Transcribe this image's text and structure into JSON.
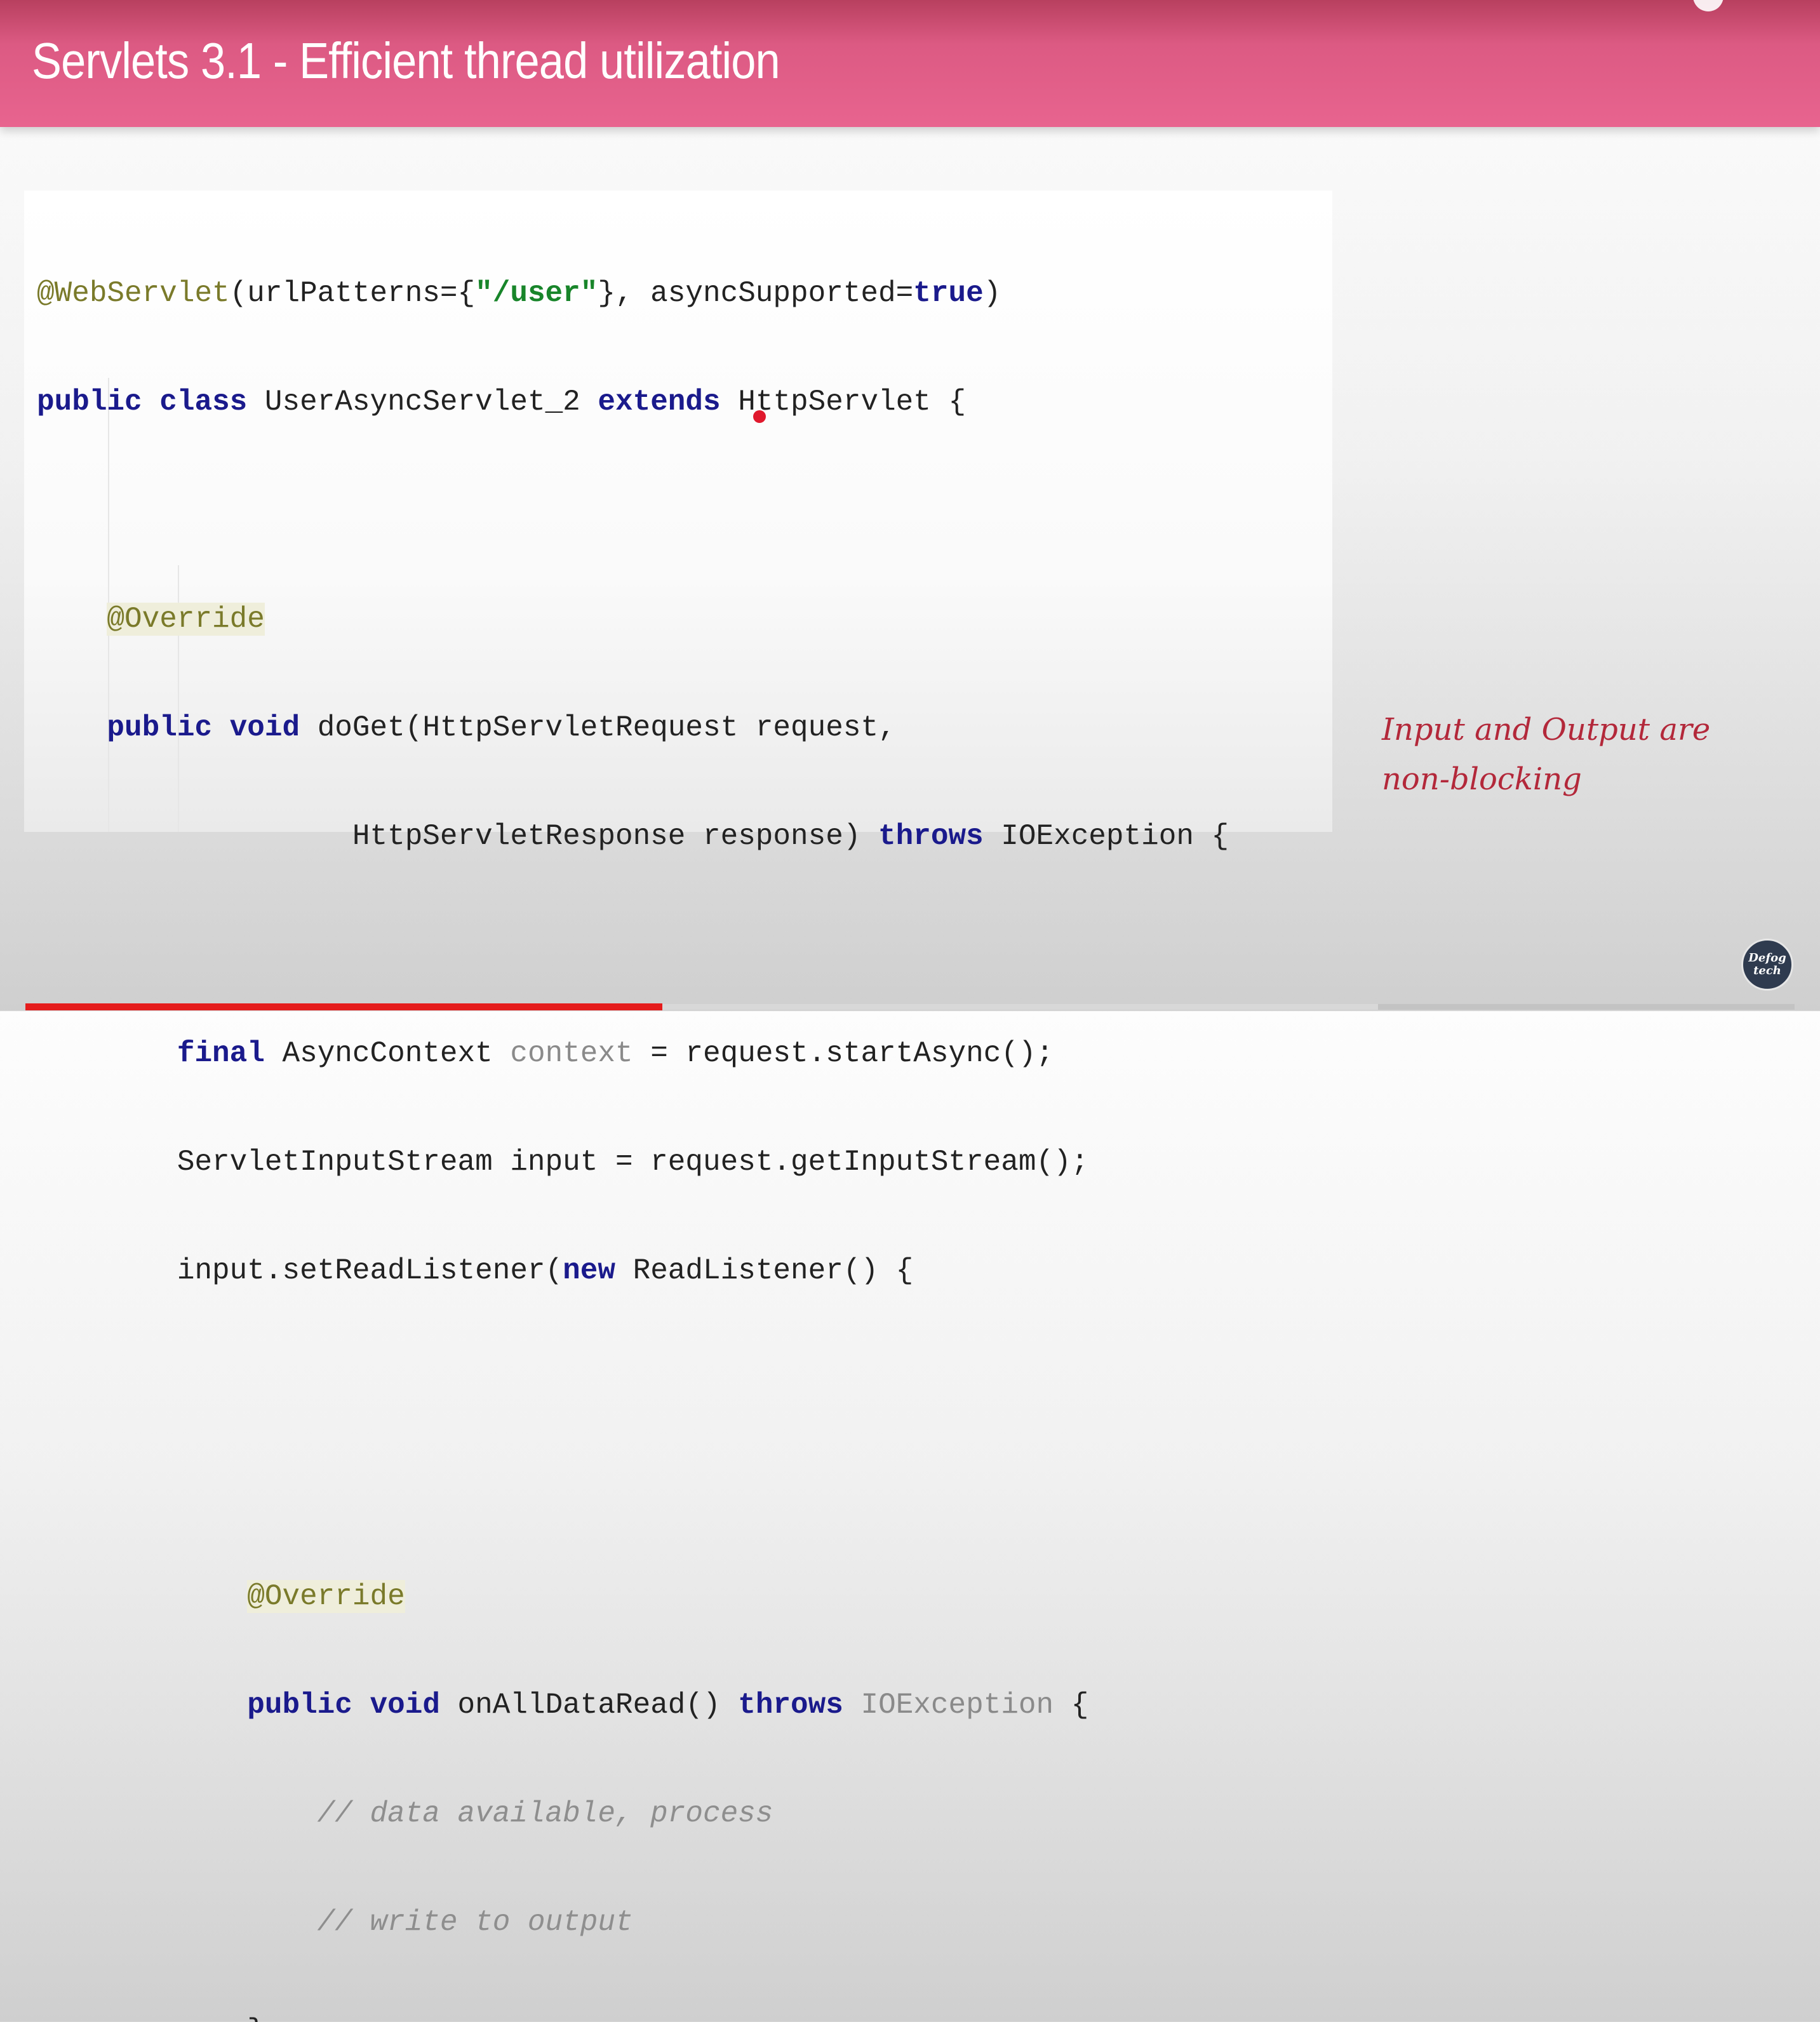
{
  "slide": {
    "title": "Servlets 3.1 - Efficient thread utilization"
  },
  "code": {
    "l1_ann": "@WebServlet",
    "l1_a": "(urlPatterns={",
    "l1_str": "\"/user\"",
    "l1_b": "}, asyncSupported=",
    "l1_kw": "true",
    "l1_c": ")",
    "l2_kw1": "public",
    "l2_kw2": "class",
    "l2_a": "UserAsyncServlet_2",
    "l2_kw3": "extends",
    "l2_b": "HttpServlet {",
    "l4_ann": "@Override",
    "l5_kw1": "public",
    "l5_kw2": "void",
    "l5_a": "doGet(HttpServletRequest request,",
    "l6_a": "HttpServletResponse response)",
    "l6_kw": "throws",
    "l6_b": "IOException {",
    "l8_kw": "final",
    "l8_a": "AsyncContext",
    "l8_dim": "context",
    "l8_b": "= request.startAsync();",
    "l9_a": "ServletInputStream input = request.getInputStream();",
    "l10_a": "input.setReadListener(",
    "l10_kw": "new",
    "l10_b": "ReadListener() {",
    "l13_ann": "@Override",
    "l14_kw1": "public",
    "l14_kw2": "void",
    "l14_a": "onAllDataRead()",
    "l14_kw3": "throws",
    "l14_dim": "IOException",
    "l14_b": "{",
    "l15_cm": "// data available, process",
    "l16_cm": "// write to output",
    "l17_a": "}"
  },
  "note": {
    "line1": "Input and Output are",
    "line2": "non-blocking"
  },
  "logo": {
    "line1": "Defog",
    "line2": "tech"
  },
  "player": {
    "progress": 0.36
  },
  "colors": {
    "header": "#e8648f",
    "keyword": "#1a1a8c",
    "string": "#18852a",
    "annotation": "#7a7a2a",
    "note": "#b3283a",
    "progress": "#e51c1c"
  }
}
